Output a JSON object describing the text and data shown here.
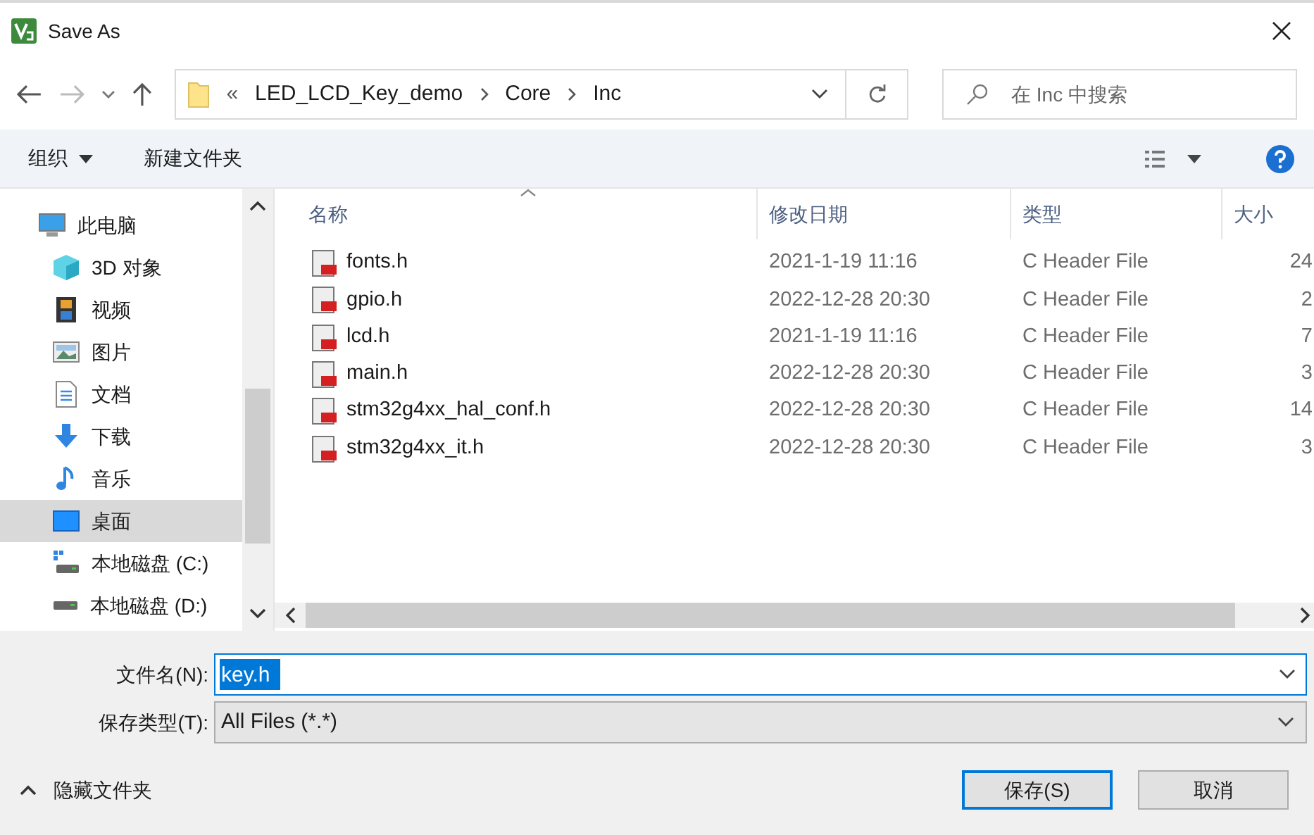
{
  "window": {
    "title": "Save As"
  },
  "address": {
    "overflow": "«",
    "crumbs": [
      "LED_LCD_Key_demo",
      "Core",
      "Inc"
    ]
  },
  "search": {
    "placeholder": "在 Inc 中搜索"
  },
  "toolbar": {
    "organize": "组织",
    "new_folder": "新建文件夹"
  },
  "nav": [
    {
      "label": "此电脑",
      "kind": "pc",
      "selected": false,
      "children": [
        {
          "label": "3D 对象",
          "kind": "cube",
          "selected": false
        },
        {
          "label": "视频",
          "kind": "video",
          "selected": false
        },
        {
          "label": "图片",
          "kind": "pictures",
          "selected": false
        },
        {
          "label": "文档",
          "kind": "docs",
          "selected": false
        },
        {
          "label": "下载",
          "kind": "download",
          "selected": false
        },
        {
          "label": "音乐",
          "kind": "music",
          "selected": false
        },
        {
          "label": "桌面",
          "kind": "desktop",
          "selected": true
        },
        {
          "label": "本地磁盘 (C:)",
          "kind": "sysdrive",
          "selected": false
        },
        {
          "label": "本地磁盘 (D:)",
          "kind": "drive",
          "selected": false
        }
      ]
    }
  ],
  "table": {
    "columns": [
      "名称",
      "修改日期",
      "类型",
      "大小"
    ],
    "rows": [
      {
        "name": "fonts.h",
        "modified": "2021-1-19 11:16",
        "type": "C Header File",
        "size": "24"
      },
      {
        "name": "gpio.h",
        "modified": "2022-12-28 20:30",
        "type": "C Header File",
        "size": "2"
      },
      {
        "name": "lcd.h",
        "modified": "2021-1-19 11:16",
        "type": "C Header File",
        "size": "7"
      },
      {
        "name": "main.h",
        "modified": "2022-12-28 20:30",
        "type": "C Header File",
        "size": "3"
      },
      {
        "name": "stm32g4xx_hal_conf.h",
        "modified": "2022-12-28 20:30",
        "type": "C Header File",
        "size": "14"
      },
      {
        "name": "stm32g4xx_it.h",
        "modified": "2022-12-28 20:30",
        "type": "C Header File",
        "size": "3"
      }
    ]
  },
  "form": {
    "filename_label": "文件名(N):",
    "filename": "key.h",
    "type_label": "保存类型(T):",
    "type": "All Files (*.*)"
  },
  "footer": {
    "hide_folders": "隐藏文件夹",
    "buttons": [
      "保存(S)",
      "取消"
    ]
  }
}
